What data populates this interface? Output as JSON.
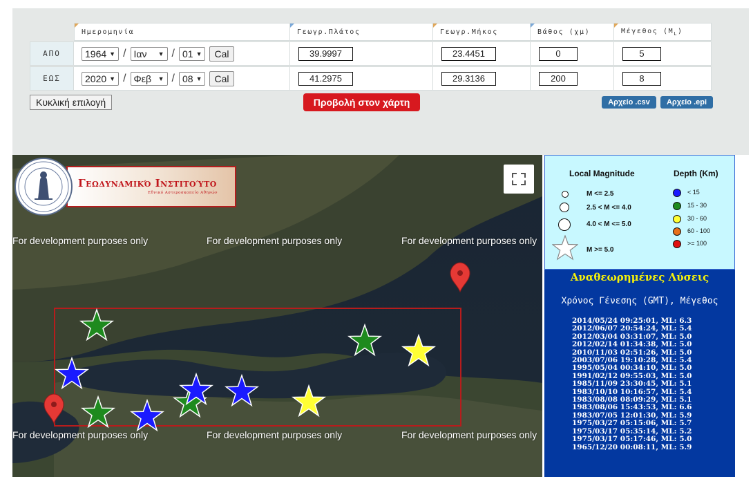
{
  "filter": {
    "headers": {
      "date": "Ημερομηνία",
      "latitude": "Γεωγρ.Πλάτος",
      "longitude": "Γεωγρ.Μήκος",
      "depth": "Βάθος (χμ)",
      "magnitude_prefix": "Μέγεθος (M",
      "magnitude_sub": "L",
      "magnitude_suffix": ")"
    },
    "from": {
      "label": "ΑΠΟ",
      "year": "1964",
      "month": "Ιαν",
      "day": "01",
      "cal": "Cal",
      "latitude": "39.9997",
      "longitude": "23.4451",
      "depth": "0",
      "magnitude": "5"
    },
    "to": {
      "label": "ΕΩΣ",
      "year": "2020",
      "month": "Φεβ",
      "day": "08",
      "cal": "Cal",
      "latitude": "41.2975",
      "longitude": "29.3136",
      "depth": "200",
      "magnitude": "8"
    },
    "date_separator": "/",
    "dropdown_arrow": "▼",
    "circular_selection": "Κυκλική επιλογή",
    "show_on_map": "Προβολή στον χάρτη",
    "csv_file": "Αρχείο .csv",
    "epi_file": "Αρχείο .epi"
  },
  "map": {
    "watermark": "For development purposes only",
    "logo_title": "Γεωδυναμικό Ινστιτούτο",
    "logo_subtitle": "Εθνικό Αστεροσκοπείο Αθηνών",
    "fullscreen_icon": "fullscreen-icon",
    "markers": [
      {
        "type": "star",
        "depth_class": "15 - 30"
      },
      {
        "type": "star",
        "depth_class": "< 15"
      },
      {
        "type": "star",
        "depth_class": "15 - 30"
      },
      {
        "type": "star",
        "depth_class": "< 15"
      },
      {
        "type": "star",
        "depth_class": "15 - 30"
      },
      {
        "type": "star",
        "depth_class": "< 15"
      },
      {
        "type": "star",
        "depth_class": "< 15"
      },
      {
        "type": "star",
        "depth_class": "30 - 60"
      },
      {
        "type": "star",
        "depth_class": "15 - 30"
      },
      {
        "type": "star",
        "depth_class": "30 - 60"
      }
    ]
  },
  "legend": {
    "magnitude_title": "Local Magnitude",
    "depth_title": "Depth (Km)",
    "magnitude_classes": [
      "M <= 2.5",
      "2.5 < M <= 4.0",
      "4.0 < M <= 5.0",
      "M >= 5.0"
    ],
    "depth_classes": [
      {
        "label": "< 15",
        "color": "#1a1aff"
      },
      {
        "label": "15 - 30",
        "color": "#1e8a1e"
      },
      {
        "label": "30 - 60",
        "color": "#ffff33"
      },
      {
        "label": "60 - 100",
        "color": "#e8701a"
      },
      {
        "label": ">= 100",
        "color": "#e01010"
      }
    ]
  },
  "revised": {
    "title": "Αναθεωρημένες Λύσεις",
    "subtitle": "Χρόνος Γένεσης (GMT),  Μέγεθος",
    "items": [
      "2014/05/24 09:25:01,  ML: 6.3",
      "2012/06/07 20:54:24,  ML: 5.4",
      "2012/03/04 03:31:07,  ML: 5.0",
      "2012/02/14 01:34:38,  ML: 5.0",
      "2010/11/03 02:51:26,  ML: 5.0",
      "2003/07/06 19:10:28,  ML: 5.4",
      "1995/05/04 00:34:10,  ML: 5.0",
      "1991/02/12 09:55:03,  ML: 5.0",
      "1985/11/09 23:30:45,  ML: 5.1",
      "1983/10/10 10:16:57,  ML: 5.4",
      "1983/08/08 08:09:29,  ML: 5.1",
      "1983/08/06 15:43:53,  ML: 6.6",
      "1983/07/05 12:01:30,  ML: 5.9",
      "1975/03/27 05:15:06,  ML: 5.7",
      "1975/03/17 05:35:14,  ML: 5.2",
      "1975/03/17 05:17:46,  ML: 5.0",
      "1965/12/20 00:08:11,  ML: 5.9"
    ]
  }
}
